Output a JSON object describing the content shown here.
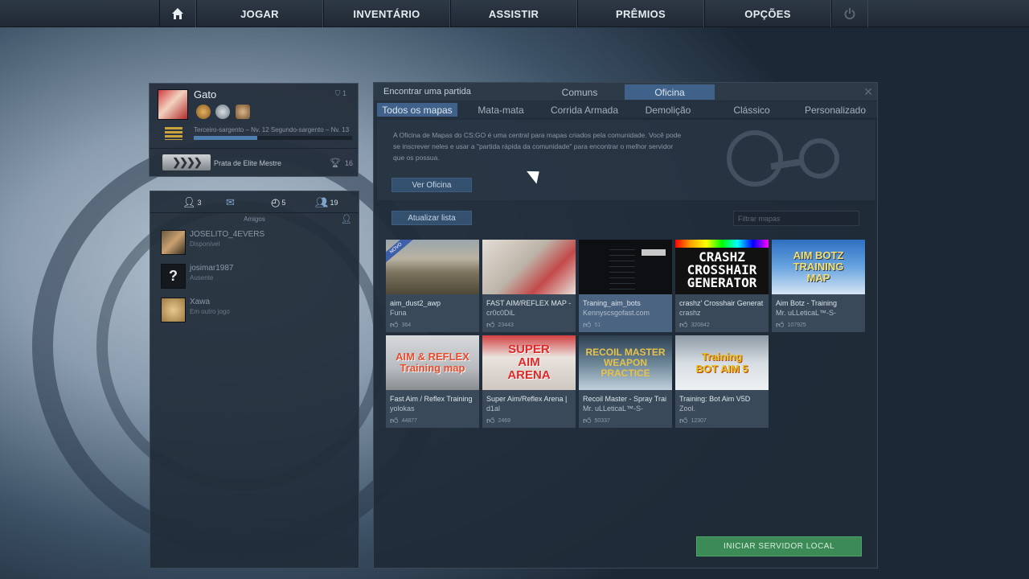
{
  "nav": {
    "items": [
      "JOGAR",
      "INVENTÁRIO",
      "ASSISTIR",
      "PRÊMIOS",
      "OPÇÕES"
    ]
  },
  "profile": {
    "name": "Gato",
    "top_count": "1",
    "rank_text": "Terceiro-sargento – Nv. 12 Segundo-sargento – Nv. 13",
    "xp_fraction": 0.4,
    "skill_group": "Prata de Elite Mestre",
    "trophy_count": "16"
  },
  "friends": {
    "tabs": [
      {
        "icon": "person-icon",
        "count": "3"
      },
      {
        "icon": "mail-icon",
        "count": ""
      },
      {
        "icon": "history-icon",
        "count": "5"
      },
      {
        "icon": "group-icon",
        "count": "19"
      }
    ],
    "header": "Amigos",
    "list": [
      {
        "name": "JOSELITO_4EVERS",
        "status": "Disponível"
      },
      {
        "name": "josimar1987",
        "status": "Ausente"
      },
      {
        "name": "Xawa",
        "status": "Em outro jogo"
      }
    ]
  },
  "main": {
    "find_label": "Encontrar uma partida",
    "top_tabs": [
      "Comuns",
      "Oficina"
    ],
    "active_top_tab": "Oficina",
    "sub_tabs": [
      "Todos os mapas",
      "Mata-mata",
      "Corrida Armada",
      "Demolição",
      "Clássico",
      "Personalizado"
    ],
    "active_sub_tab": "Todos os mapas",
    "info_text": "A Oficina de Mapas do CS:GO é uma central para mapas criados pela comunidade. Você pode se inscrever neles e usar a \"partida rápida da comunidade\" para encontrar o melhor servidor que os possua.",
    "ver_oficina": "Ver Oficina",
    "atualizar_lista": "Atualizar lista",
    "filter_placeholder": "Filtrar mapas",
    "start_button": "INICIAR SERVIDOR LOCAL"
  },
  "maps": [
    {
      "title": "aim_dust2_awp",
      "author": "Funa",
      "likes": "364",
      "thumb_text": "",
      "badge": "NOVO"
    },
    {
      "title": "FAST AIM/REFLEX MAP -",
      "author": "cr0c0DiL",
      "likes": "23443",
      "thumb_text": ""
    },
    {
      "title": "Traning_aim_bots",
      "author": "Kennyscsgofast.com",
      "likes": "51",
      "thumb_text": ""
    },
    {
      "title": "crashz' Crosshair Generat",
      "author": "crashz",
      "likes": "320842",
      "thumb_text": "CRASHZ CROSSHAIR GENERATOR"
    },
    {
      "title": "Aim Botz - Training",
      "author": "Mr. uLLeticaL™-S-",
      "likes": "107925",
      "thumb_text": "AIM BOTZ TRAINING MAP"
    },
    {
      "title": "Fast Aim / Reflex Training",
      "author": "yolokas",
      "likes": "44877",
      "thumb_text": "AIM & REFLEX Training map"
    },
    {
      "title": "Super Aim/Reflex Arena |",
      "author": "d1al",
      "likes": "2469",
      "thumb_text": "SUPER AIM ARENA"
    },
    {
      "title": "Recoil Master - Spray Trai",
      "author": "Mr. uLLeticaL™-S-",
      "likes": "50337",
      "thumb_text": "RECOIL MASTER WEAPON PRACTICE"
    },
    {
      "title": "Training: Bot Aim V5D",
      "author": "Zool.",
      "likes": "12307",
      "thumb_text": "Training BOT AIM 5"
    }
  ]
}
